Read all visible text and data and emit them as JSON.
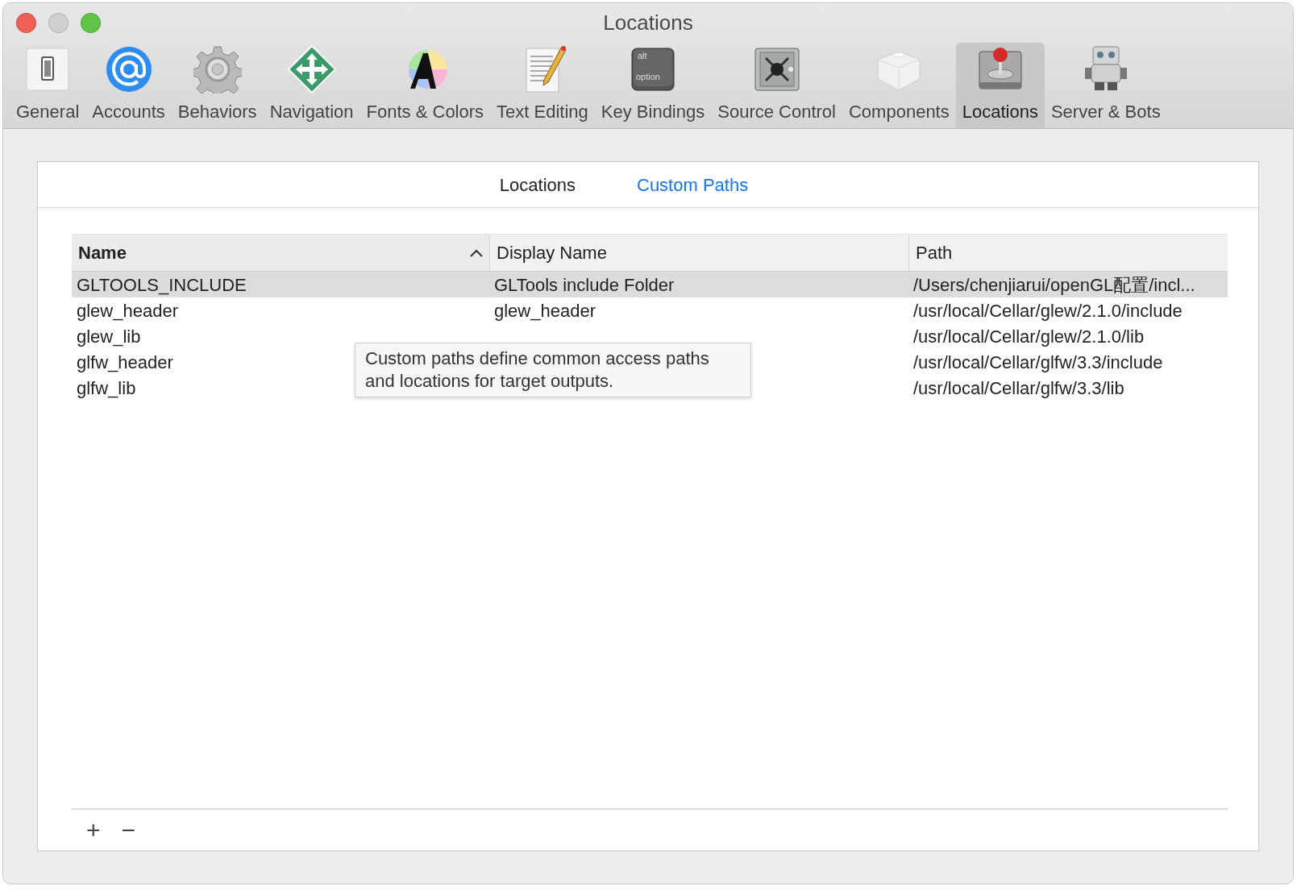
{
  "window": {
    "title": "Locations"
  },
  "toolbar": [
    {
      "label": "General",
      "selected": false
    },
    {
      "label": "Accounts",
      "selected": false
    },
    {
      "label": "Behaviors",
      "selected": false
    },
    {
      "label": "Navigation",
      "selected": false
    },
    {
      "label": "Fonts & Colors",
      "selected": false
    },
    {
      "label": "Text Editing",
      "selected": false
    },
    {
      "label": "Key Bindings",
      "selected": false
    },
    {
      "label": "Source Control",
      "selected": false
    },
    {
      "label": "Components",
      "selected": false
    },
    {
      "label": "Locations",
      "selected": true
    },
    {
      "label": "Server & Bots",
      "selected": false
    }
  ],
  "key_icon": {
    "top": "alt",
    "bottom": "option"
  },
  "tabs": [
    {
      "label": "Locations",
      "selected": false
    },
    {
      "label": "Custom Paths",
      "selected": true
    }
  ],
  "table": {
    "columns": [
      {
        "label": "Name",
        "sorted": true
      },
      {
        "label": "Display Name",
        "sorted": false
      },
      {
        "label": "Path",
        "sorted": false
      }
    ],
    "rows": [
      {
        "name": "GLTOOLS_INCLUDE",
        "display_name": "GLTools include Folder",
        "path": "/Users/chenjiarui/openGL配置/incl...",
        "selected": true
      },
      {
        "name": "glew_header",
        "display_name": "glew_header",
        "path": "/usr/local/Cellar/glew/2.1.0/include",
        "selected": false
      },
      {
        "name": "glew_lib",
        "path": "/usr/local/Cellar/glew/2.1.0/lib",
        "selected": false
      },
      {
        "name": "glfw_header",
        "path": "/usr/local/Cellar/glfw/3.3/include",
        "selected": false
      },
      {
        "name": "glfw_lib",
        "path": "/usr/local/Cellar/glfw/3.3/lib",
        "selected": false
      }
    ]
  },
  "tooltip": {
    "text": "Custom paths define common access paths and locations for target outputs."
  },
  "footer_buttons": [
    "+",
    "−"
  ]
}
